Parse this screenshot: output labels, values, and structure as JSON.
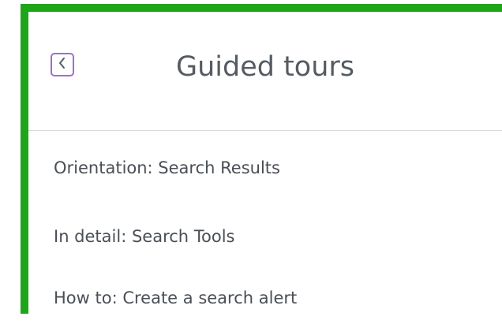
{
  "header": {
    "title": "Guided tours",
    "back_icon": "chevron-left-icon"
  },
  "tours": [
    {
      "label": "Orientation: Search Results"
    },
    {
      "label": "In detail: Search Tools"
    },
    {
      "label": "How to: Create a search alert"
    }
  ],
  "colors": {
    "frame_border": "#1fa51a",
    "back_button_border": "#a06cd5",
    "title_text": "#555b63",
    "item_text": "#4a4f56",
    "divider": "#d9d9d9"
  }
}
